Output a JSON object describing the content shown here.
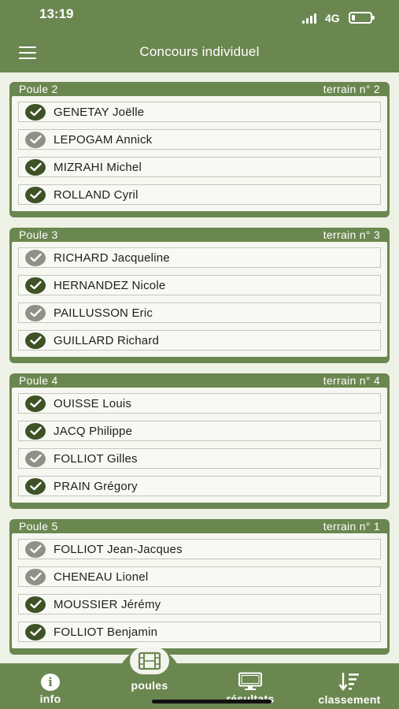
{
  "status_bar": {
    "time": "13:19",
    "network": "4G"
  },
  "header": {
    "title": "Concours individuel",
    "menu_icon": "hamburger-menu-icon"
  },
  "poules": [
    {
      "name": "Poule 2",
      "terrain": "terrain n° 2",
      "players": [
        {
          "name": "GENETAY Joëlle",
          "checked": true
        },
        {
          "name": "LEPOGAM Annick",
          "checked": false
        },
        {
          "name": "MIZRAHI Michel",
          "checked": true
        },
        {
          "name": "ROLLAND Cyril",
          "checked": true
        }
      ]
    },
    {
      "name": "Poule 3",
      "terrain": "terrain n° 3",
      "players": [
        {
          "name": "RICHARD Jacqueline",
          "checked": false
        },
        {
          "name": "HERNANDEZ Nicole",
          "checked": true
        },
        {
          "name": "PAILLUSSON Eric",
          "checked": false
        },
        {
          "name": "GUILLARD Richard",
          "checked": true
        }
      ]
    },
    {
      "name": "Poule 4",
      "terrain": "terrain n° 4",
      "players": [
        {
          "name": "OUISSE Louis",
          "checked": true
        },
        {
          "name": "JACQ Philippe",
          "checked": true
        },
        {
          "name": "FOLLIOT Gilles",
          "checked": false
        },
        {
          "name": "PRAIN Grégory",
          "checked": true
        }
      ]
    },
    {
      "name": "Poule 5",
      "terrain": "terrain n° 1",
      "players": [
        {
          "name": "FOLLIOT Jean-Jacques",
          "checked": false
        },
        {
          "name": "CHENEAU Lionel",
          "checked": false
        },
        {
          "name": "MOUSSIER Jérémy",
          "checked": true
        },
        {
          "name": "FOLLIOT Benjamin",
          "checked": true
        }
      ]
    }
  ],
  "bottom_nav": {
    "info": "info",
    "poules": "poules",
    "resultats": "résultats",
    "classement": "classement"
  },
  "colors": {
    "primary": "#6b8750",
    "check_on": "#3e5226",
    "check_off": "#8e9186",
    "background": "#eef1e6"
  }
}
